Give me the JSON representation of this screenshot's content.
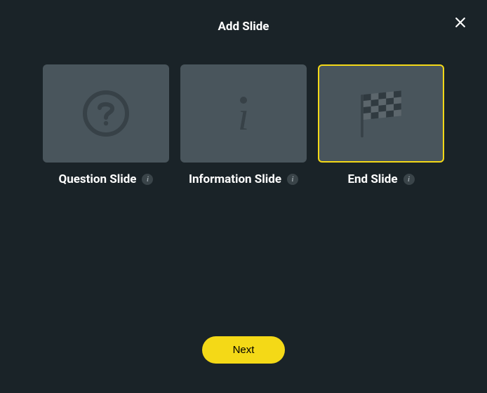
{
  "dialog": {
    "title": "Add Slide"
  },
  "cards": {
    "question": {
      "label": "Question Slide",
      "selected": false
    },
    "information": {
      "label": "Information Slide",
      "selected": false
    },
    "end": {
      "label": "End Slide",
      "selected": true
    }
  },
  "footer": {
    "next_label": "Next"
  }
}
